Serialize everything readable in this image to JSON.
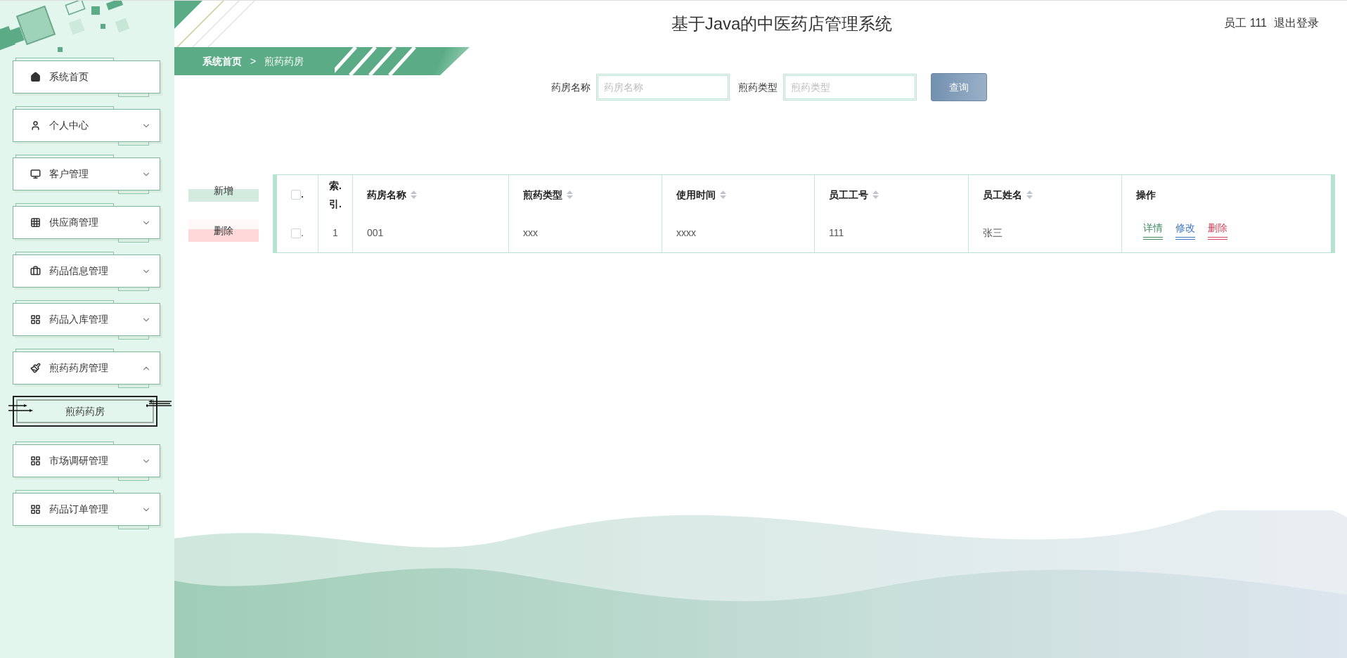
{
  "header": {
    "title": "基于Java的中医药店管理系统",
    "user": "员工 111",
    "logout": "退出登录"
  },
  "sidebar": {
    "items": [
      {
        "label": "系统首页",
        "kind": "link"
      },
      {
        "label": "个人中心",
        "kind": "menu",
        "expanded": false
      },
      {
        "label": "客户管理",
        "kind": "menu",
        "expanded": false
      },
      {
        "label": "供应商管理",
        "kind": "menu",
        "expanded": false
      },
      {
        "label": "药品信息管理",
        "kind": "menu",
        "expanded": false
      },
      {
        "label": "药品入库管理",
        "kind": "menu",
        "expanded": false
      },
      {
        "label": "煎药药房管理",
        "kind": "menu",
        "expanded": true,
        "children": [
          {
            "label": "煎药药房",
            "selected": true
          }
        ]
      },
      {
        "label": "市场调研管理",
        "kind": "menu",
        "expanded": false
      },
      {
        "label": "药品订单管理",
        "kind": "menu",
        "expanded": false
      }
    ]
  },
  "breadcrumb": {
    "items": [
      "系统首页",
      "煎药药房"
    ],
    "separator": ">"
  },
  "search": {
    "fields": [
      {
        "label": "药房名称",
        "placeholder": "药房名称"
      },
      {
        "label": "煎药类型",
        "placeholder": "煎药类型"
      }
    ],
    "button": "查询"
  },
  "actions": [
    {
      "label": "新增",
      "kind": "add"
    },
    {
      "label": "删除",
      "kind": "delete"
    }
  ],
  "table": {
    "columns": [
      {
        "kind": "checkbox",
        "label": ".",
        "checked": false
      },
      {
        "kind": "index",
        "label": "索.\n引."
      },
      {
        "kind": "text",
        "label": "药房名称",
        "sortable": true
      },
      {
        "kind": "text",
        "label": "煎药类型",
        "sortable": true
      },
      {
        "kind": "text",
        "label": "使用时间",
        "sortable": true
      },
      {
        "kind": "text",
        "label": "员工工号",
        "sortable": true
      },
      {
        "kind": "text",
        "label": "员工姓名",
        "sortable": true
      },
      {
        "kind": "actions",
        "label": "操作"
      }
    ],
    "rows": [
      {
        "selected": false,
        "cells": [
          ".",
          "1",
          "001",
          "xxx",
          "xxxx",
          "111",
          "张三"
        ],
        "actions": [
          {
            "label": "详情",
            "kind": "detail"
          },
          {
            "label": "修改",
            "kind": "edit"
          },
          {
            "label": "删除",
            "kind": "delete"
          }
        ]
      }
    ]
  }
}
